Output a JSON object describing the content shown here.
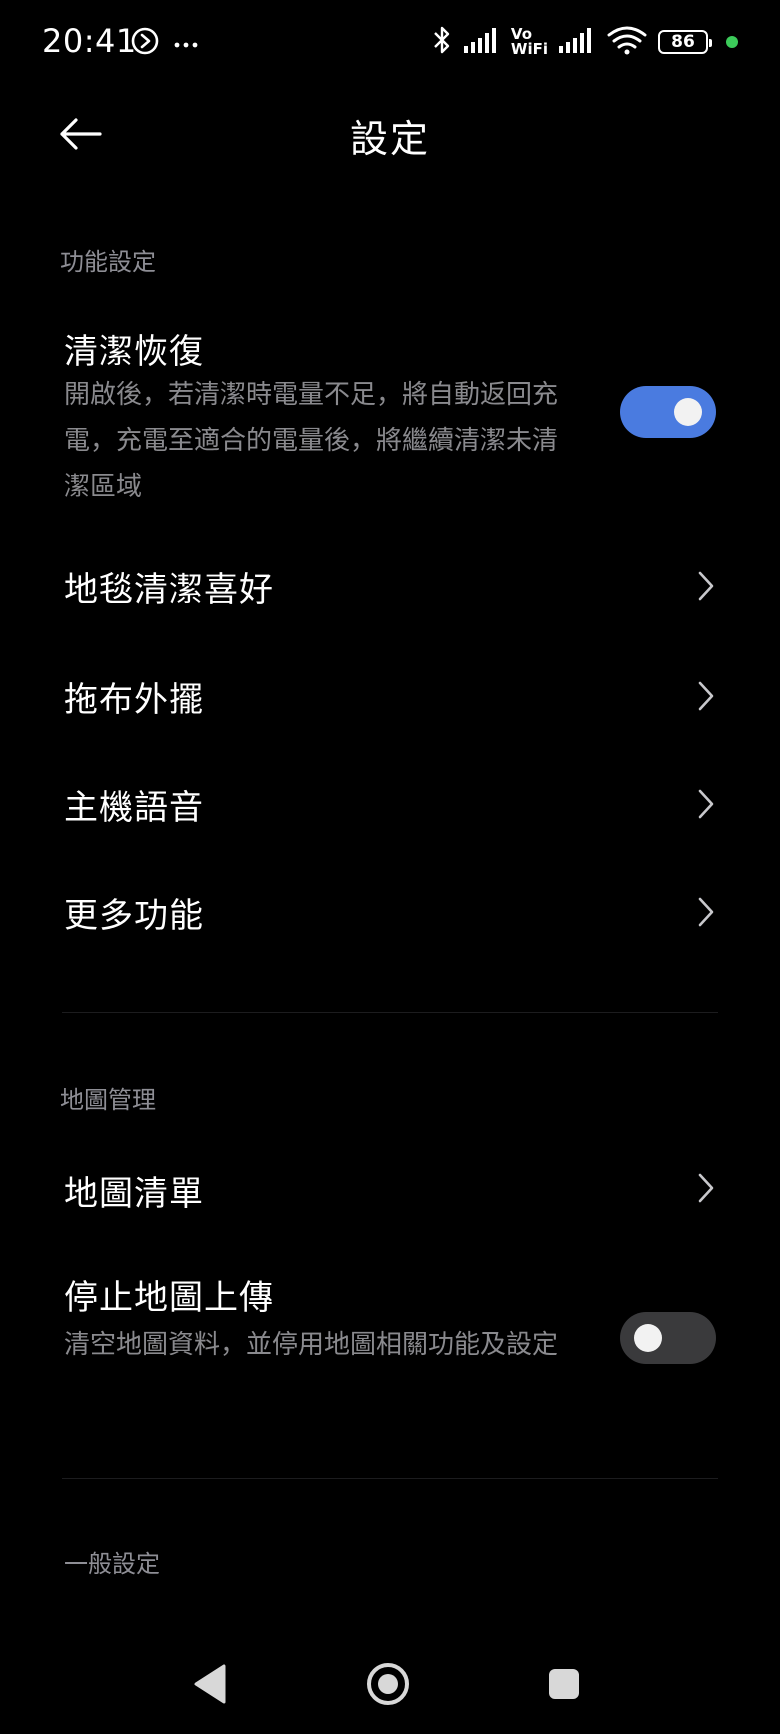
{
  "status_bar": {
    "time": "20:41",
    "vo": "Vo",
    "wifi": "WiFi",
    "battery": "86",
    "icons": [
      "media-icon",
      "more-dots-icon",
      "bluetooth-icon",
      "signal-icon",
      "vowifi-icon",
      "signal-icon",
      "wifi-icon",
      "battery-icon"
    ]
  },
  "header": {
    "title": "設定"
  },
  "sections": {
    "function": {
      "label": "功能設定",
      "cleaning_resume": {
        "title": "清潔恢復",
        "desc": "開啟後，若清潔時電量不足，將自動返回充電，充電至適合的電量後，將繼續清潔未清潔區域",
        "enabled": true
      },
      "carpet": {
        "title": "地毯清潔喜好"
      },
      "mop": {
        "title": "拖布外擺"
      },
      "voice": {
        "title": "主機語音"
      },
      "more": {
        "title": "更多功能"
      }
    },
    "map": {
      "label": "地圖管理",
      "map_list": {
        "title": "地圖清單"
      },
      "stop_upload": {
        "title": "停止地圖上傳",
        "desc": "清空地圖資料，並停用地圖相關功能及設定",
        "enabled": false
      }
    },
    "general": {
      "label": "一般設定"
    }
  },
  "colors": {
    "background": "#000000",
    "accent": "#4a7be0",
    "toggle_off": "#3a3a3c",
    "secondary_text": "#8a8a8e",
    "status_dot": "#3ccb5a"
  }
}
